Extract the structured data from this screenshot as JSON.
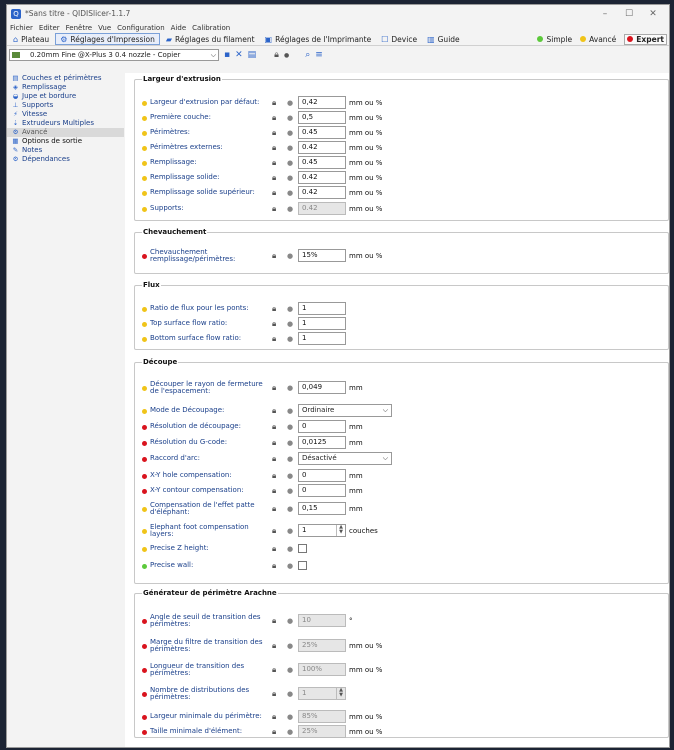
{
  "window": {
    "title": "*Sans titre - QIDISlicer-1.1.7"
  },
  "menu": [
    "Fichier",
    "Editer",
    "Fenêtre",
    "Vue",
    "Configuration",
    "Aide",
    "Calibration"
  ],
  "tabs": [
    {
      "label": "Plateau",
      "icon": "home-icon"
    },
    {
      "label": "Réglages d'Impression",
      "icon": "gear-icon",
      "active": true
    },
    {
      "label": "Réglages du filament",
      "icon": "spool-icon"
    },
    {
      "label": "Réglages de l'Imprimante",
      "icon": "printer-icon"
    },
    {
      "label": "Device",
      "icon": "device-icon"
    },
    {
      "label": "Guide",
      "icon": "book-icon"
    }
  ],
  "modes": [
    {
      "label": "Simple",
      "color": "#5cc93b"
    },
    {
      "label": "Avancé",
      "color": "#f0c419"
    },
    {
      "label": "Expert",
      "color": "#d9141e",
      "active": true
    }
  ],
  "preset": {
    "value": "0.20mm Fine @X-Plus 3 0.4 nozzle - Copier"
  },
  "nav": [
    {
      "label": "Couches et périmètres",
      "icon": "layers-icon"
    },
    {
      "label": "Remplissage",
      "icon": "infill-icon"
    },
    {
      "label": "Jupe et bordure",
      "icon": "skirt-icon"
    },
    {
      "label": "Supports",
      "icon": "support-icon"
    },
    {
      "label": "Vitesse",
      "icon": "speed-icon"
    },
    {
      "label": "Extrudeurs Multiples",
      "icon": "extruder-icon"
    },
    {
      "label": "Avancé",
      "icon": "advanced-icon",
      "selected": true
    },
    {
      "label": "Options de sortie",
      "icon": "output-icon",
      "black": true
    },
    {
      "label": "Notes",
      "icon": "notes-icon"
    },
    {
      "label": "Dépendances",
      "icon": "dependencies-icon"
    }
  ],
  "colors": {
    "yellow": "#f0c419",
    "red": "#d9141e",
    "green": "#5cc93b"
  },
  "groups": [
    {
      "title": "Largeur d'extrusion",
      "rows": [
        {
          "label": "Largeur d'extrusion par défaut:",
          "dot": "yellow",
          "value": "0,42",
          "unit": "mm ou %"
        },
        {
          "label": "Première couche:",
          "dot": "yellow",
          "value": "0,5",
          "unit": "mm ou %"
        },
        {
          "label": "Périmètres:",
          "dot": "yellow",
          "value": "0.45",
          "unit": "mm ou %"
        },
        {
          "label": "Périmètres externes:",
          "dot": "yellow",
          "value": "0.42",
          "unit": "mm ou %"
        },
        {
          "label": "Remplissage:",
          "dot": "yellow",
          "value": "0.45",
          "unit": "mm ou %"
        },
        {
          "label": "Remplissage solide:",
          "dot": "yellow",
          "value": "0.42",
          "unit": "mm ou %"
        },
        {
          "label": "Remplissage solide supérieur:",
          "dot": "yellow",
          "value": "0.42",
          "unit": "mm ou %"
        },
        {
          "label": "Supports:",
          "dot": "yellow",
          "value": "0.42",
          "unit": "mm ou %",
          "disabled": true
        }
      ]
    },
    {
      "title": "Chevauchement",
      "rows": [
        {
          "label": "Chevauchement remplissage/périmètres:",
          "dot": "red",
          "value": "15%",
          "unit": "mm ou %"
        }
      ]
    },
    {
      "title": "Flux",
      "rows": [
        {
          "label": "Ratio de flux pour les ponts:",
          "dot": "yellow",
          "value": "1",
          "unit": ""
        },
        {
          "label": "Top surface flow ratio:",
          "dot": "yellow",
          "value": "1",
          "unit": ""
        },
        {
          "label": "Bottom surface flow ratio:",
          "dot": "yellow",
          "value": "1",
          "unit": ""
        }
      ]
    },
    {
      "title": "Découpe",
      "rows": [
        {
          "label": "Découper le rayon de fermeture de l'espacement:",
          "dot": "yellow",
          "value": "0,049",
          "unit": "mm"
        },
        {
          "label": "Mode de Découpage:",
          "dot": "yellow",
          "value": "Ordinaire",
          "type": "dropdown"
        },
        {
          "label": "Résolution de découpage:",
          "dot": "red",
          "value": "0",
          "unit": "mm"
        },
        {
          "label": "Résolution du G-code:",
          "dot": "red",
          "value": "0,0125",
          "unit": "mm"
        },
        {
          "label": "Raccord d'arc:",
          "dot": "red",
          "value": "Désactivé",
          "type": "dropdown"
        },
        {
          "label": "X-Y hole compensation:",
          "dot": "red",
          "value": "0",
          "unit": "mm"
        },
        {
          "label": "X-Y contour compensation:",
          "dot": "red",
          "value": "0",
          "unit": "mm"
        },
        {
          "label": "Compensation de l'effet patte d'éléphant:",
          "dot": "yellow",
          "value": "0,15",
          "unit": "mm"
        },
        {
          "label": "Elephant foot compensation layers:",
          "dot": "yellow",
          "value": "1",
          "unit": "couches",
          "type": "spin"
        },
        {
          "label": "Precise Z height:",
          "dot": "yellow",
          "type": "checkbox"
        },
        {
          "label": "Precise wall:",
          "dot": "green",
          "type": "checkbox"
        }
      ]
    },
    {
      "title": "Générateur de périmètre Arachne",
      "rows": [
        {
          "label": "Angle de seuil de transition des périmètres:",
          "dot": "red",
          "value": "10",
          "unit": "°",
          "disabled": true
        },
        {
          "label": "Marge du filtre de transition des périmètres:",
          "dot": "red",
          "value": "25%",
          "unit": "mm ou %",
          "disabled": true
        },
        {
          "label": "Longueur de transition des périmètres:",
          "dot": "red",
          "value": "100%",
          "unit": "mm ou %",
          "disabled": true
        },
        {
          "label": "Nombre de distributions des périmètres:",
          "dot": "red",
          "value": "1",
          "unit": "",
          "disabled": true,
          "type": "spin"
        },
        {
          "label": "Largeur minimale du périmètre:",
          "dot": "red",
          "value": "85%",
          "unit": "mm ou %",
          "disabled": true
        },
        {
          "label": "Taille minimale d'élément:",
          "dot": "red",
          "value": "25%",
          "unit": "mm ou %",
          "disabled": true
        }
      ]
    }
  ]
}
